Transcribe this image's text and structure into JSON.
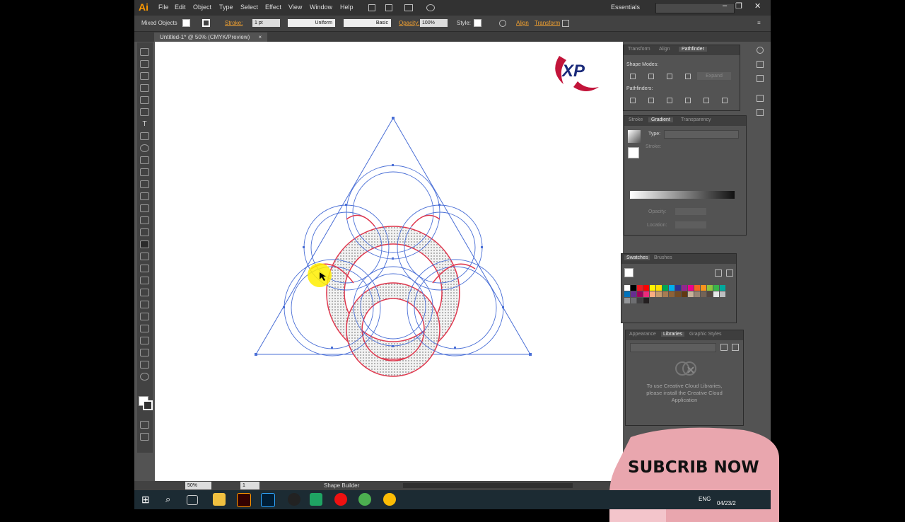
{
  "app": {
    "logo": "Ai",
    "workspace": "Essentials"
  },
  "menu": [
    "File",
    "Edit",
    "Object",
    "Type",
    "Select",
    "Effect",
    "View",
    "Window",
    "Help"
  ],
  "control_bar": {
    "selection": "Mixed Objects",
    "stroke_label": "Stroke:",
    "stroke_weight": "1 pt",
    "profile": "Uniform",
    "brush": "Basic",
    "opacity_label": "Opacity:",
    "opacity_value": "100%",
    "style_label": "Style:",
    "align_link": "Align",
    "transform_link": "Transform"
  },
  "document_tab": {
    "title": "Untitled-1* @ 50% (CMYK/Preview)",
    "close": "×"
  },
  "status_bar": {
    "zoom": "50%",
    "page": "1",
    "tool": "Shape Builder"
  },
  "pathfinder_panel": {
    "tabs": [
      "Transform",
      "Align",
      "Pathfinder"
    ],
    "shape_modes_label": "Shape Modes:",
    "expand_label": "Expand",
    "pathfinders_label": "Pathfinders:"
  },
  "gradient_panel": {
    "tabs": [
      "Stroke",
      "Gradient",
      "Transparency"
    ],
    "type_label": "Type:",
    "stroke_label": "Stroke:",
    "opacity_label": "Opacity:",
    "location_label": "Location:"
  },
  "swatches_panel": {
    "tabs": [
      "Swatches",
      "Brushes"
    ],
    "colors": [
      "#ffffff",
      "#000000",
      "#ed1c24",
      "#ff0000",
      "#fff200",
      "#ffde00",
      "#00a651",
      "#00aeef",
      "#2e3192",
      "#92278f",
      "#ec008c",
      "#f26522",
      "#f7941d",
      "#8dc63f",
      "#39b54a",
      "#00a99d",
      "#0072bc",
      "#662d91",
      "#9e005d",
      "#ee2a7b",
      "#f9ad81",
      "#c69c6d",
      "#a67c52",
      "#8c6239",
      "#754c24",
      "#603913",
      "#c7b299",
      "#998675",
      "#736357",
      "#534741",
      "#e6e7e8",
      "#bcbec0",
      "#939598",
      "#6d6e71",
      "#414042",
      "#231f20"
    ]
  },
  "libraries_panel": {
    "tabs": [
      "Appearance",
      "Libraries",
      "Graphic Styles"
    ],
    "message": "To use Creative Cloud Libraries, please install the Creative Cloud Application"
  },
  "watermark": {
    "logo_text": "XP"
  },
  "subscribe_banner": {
    "text": "SUBCRIB NOW"
  },
  "taskbar": {
    "lang": "ENG",
    "date": "04/23/2"
  },
  "colors": {
    "accent": "#ff9a00",
    "selection_blue": "#4a6fd6",
    "path_red": "#e0384e",
    "subscribe_bg": "#e9a6ae"
  }
}
